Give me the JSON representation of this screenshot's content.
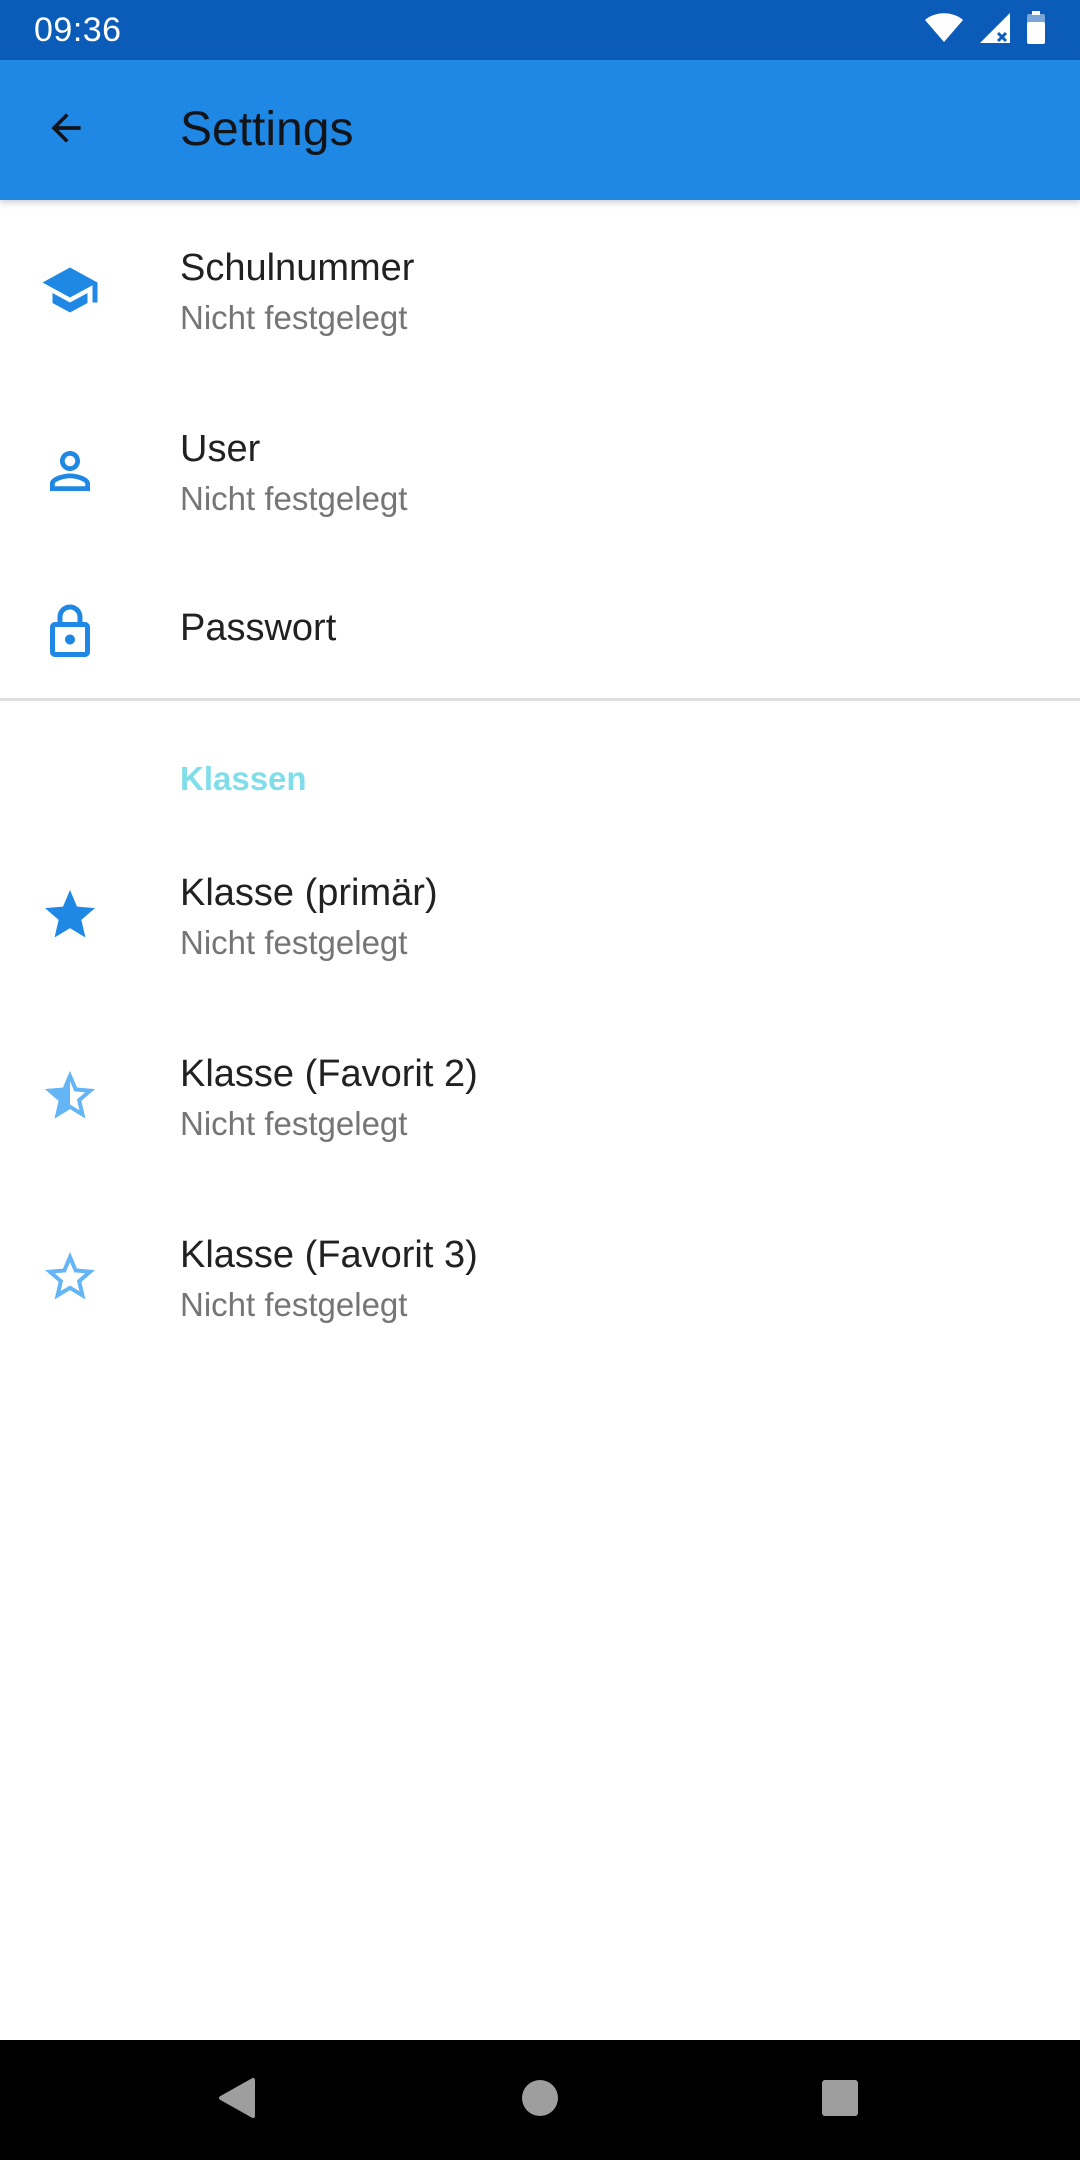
{
  "status_bar": {
    "time": "09:36",
    "icons": [
      "wifi-icon",
      "signal-icon",
      "battery-icon"
    ]
  },
  "app_bar": {
    "title": "Settings",
    "back_icon": "arrow-back-icon"
  },
  "colors": {
    "status_bar": "#0B5CB8",
    "app_bar": "#1F88E5",
    "icon_blue": "#1F88E5",
    "icon_light_blue": "#64B5F6",
    "category_accent": "#80DEEA"
  },
  "account_section": {
    "items": [
      {
        "icon": "school-icon",
        "title": "Schulnummer",
        "summary": "Nicht festgelegt"
      },
      {
        "icon": "person-icon",
        "title": "User",
        "summary": "Nicht festgelegt"
      },
      {
        "icon": "lock-icon",
        "title": "Passwort"
      }
    ]
  },
  "classes_section": {
    "header": "Klassen",
    "items": [
      {
        "icon": "star-filled-icon",
        "title": "Klasse (primär)",
        "summary": "Nicht festgelegt"
      },
      {
        "icon": "star-half-icon",
        "title": "Klasse (Favorit 2)",
        "summary": "Nicht festgelegt"
      },
      {
        "icon": "star-outline-icon",
        "title": "Klasse (Favorit 3)",
        "summary": "Nicht festgelegt"
      }
    ]
  },
  "nav_bar": {
    "buttons": [
      "back-triangle-icon",
      "home-circle-icon",
      "recents-square-icon"
    ]
  }
}
